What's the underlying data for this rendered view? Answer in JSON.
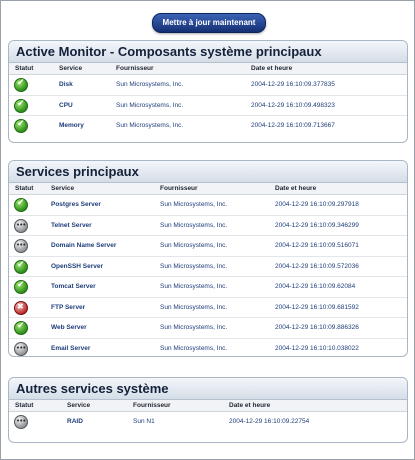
{
  "toolbar": {
    "update_label": "Mettre à jour maintenant"
  },
  "columns": {
    "status": "Statut",
    "service": "Service",
    "provider": "Fournisseur",
    "datetime": "Date et heure"
  },
  "sections": [
    {
      "title": "Active Monitor - Composants système principaux",
      "rows": [
        {
          "status": "ok",
          "service": "Disk",
          "provider": "Sun Microsystems, Inc.",
          "datetime": "2004-12-29 16:10:09.377835"
        },
        {
          "status": "ok",
          "service": "CPU",
          "provider": "Sun Microsystems, Inc.",
          "datetime": "2004-12-29 16:10:09.498323"
        },
        {
          "status": "ok",
          "service": "Memory",
          "provider": "Sun Microsystems, Inc.",
          "datetime": "2004-12-29 16:10:09.713667"
        }
      ]
    },
    {
      "title": "Services principaux",
      "rows": [
        {
          "status": "ok",
          "service": "Postgres Server",
          "provider": "Sun Microsystems, Inc.",
          "datetime": "2004-12-29 16:10:09.297918"
        },
        {
          "status": "unknown",
          "service": "Telnet Server",
          "provider": "Sun Microsystems, Inc.",
          "datetime": "2004-12-29 16:10:09.346299"
        },
        {
          "status": "unknown",
          "service": "Domain Name Server",
          "provider": "Sun Microsystems, Inc.",
          "datetime": "2004-12-29 16:10:09.516071"
        },
        {
          "status": "ok",
          "service": "OpenSSH Server",
          "provider": "Sun Microsystems, Inc.",
          "datetime": "2004-12-29 16:10:09.572036"
        },
        {
          "status": "ok",
          "service": "Tomcat Server",
          "provider": "Sun Microsystems, Inc.",
          "datetime": "2004-12-29 16:10:09.62084"
        },
        {
          "status": "error",
          "service": "FTP Server",
          "provider": "Sun Microsystems, Inc.",
          "datetime": "2004-12-29 16:10:09.681592"
        },
        {
          "status": "ok",
          "service": "Web Server",
          "provider": "Sun Microsystems, Inc.",
          "datetime": "2004-12-29 16:10:09.886326"
        },
        {
          "status": "unknown",
          "service": "Email Server",
          "provider": "Sun Microsystems, Inc.",
          "datetime": "2004-12-29 16:10:10.038022"
        }
      ]
    },
    {
      "title": "Autres services système",
      "rows": [
        {
          "status": "unknown",
          "service": "RAID",
          "provider": "Sun N1",
          "datetime": "2004-12-29 16:10:09.22754"
        }
      ]
    }
  ]
}
